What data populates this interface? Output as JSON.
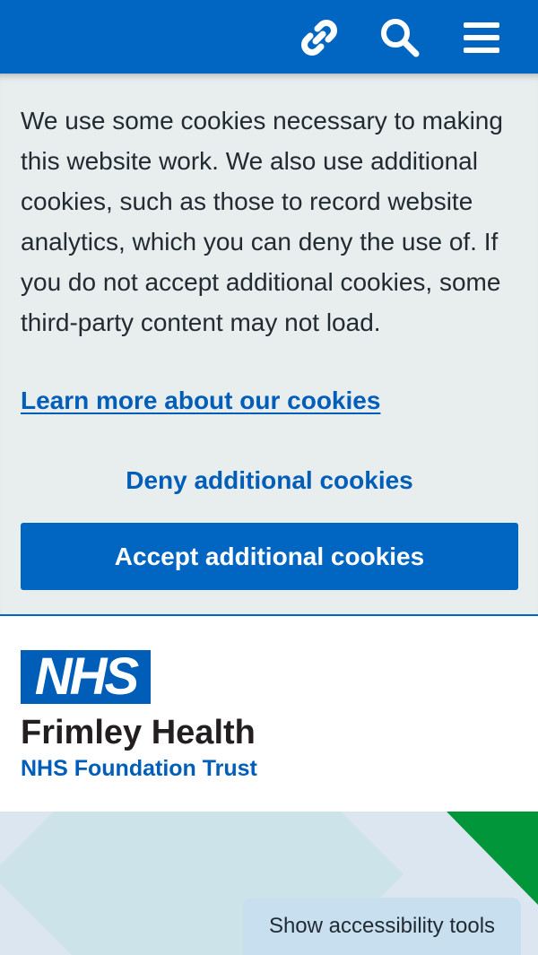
{
  "topbar": {
    "icons": [
      "link-icon",
      "search-icon",
      "menu-icon"
    ],
    "color": "#0066c1"
  },
  "cookie_banner": {
    "text": "We use some cookies necessary to making this website work. We also use additional cookies, such as those to record website analytics, which you can deny the use of. If you do not accept additional cookies, some third-party content may not load.",
    "learn_more_label": "Learn more about our cookies",
    "deny_label": "Deny additional cookies",
    "accept_label": "Accept additional cookies"
  },
  "header": {
    "logo_text": "NHS",
    "org_name": "Frimley Health",
    "org_sub": "NHS Foundation Trust"
  },
  "accessibility": {
    "button_label": "Show accessibility tools"
  },
  "colors": {
    "nhs_blue": "#005eb8",
    "banner_bg": "#e8edee",
    "accent_green": "#009639"
  }
}
